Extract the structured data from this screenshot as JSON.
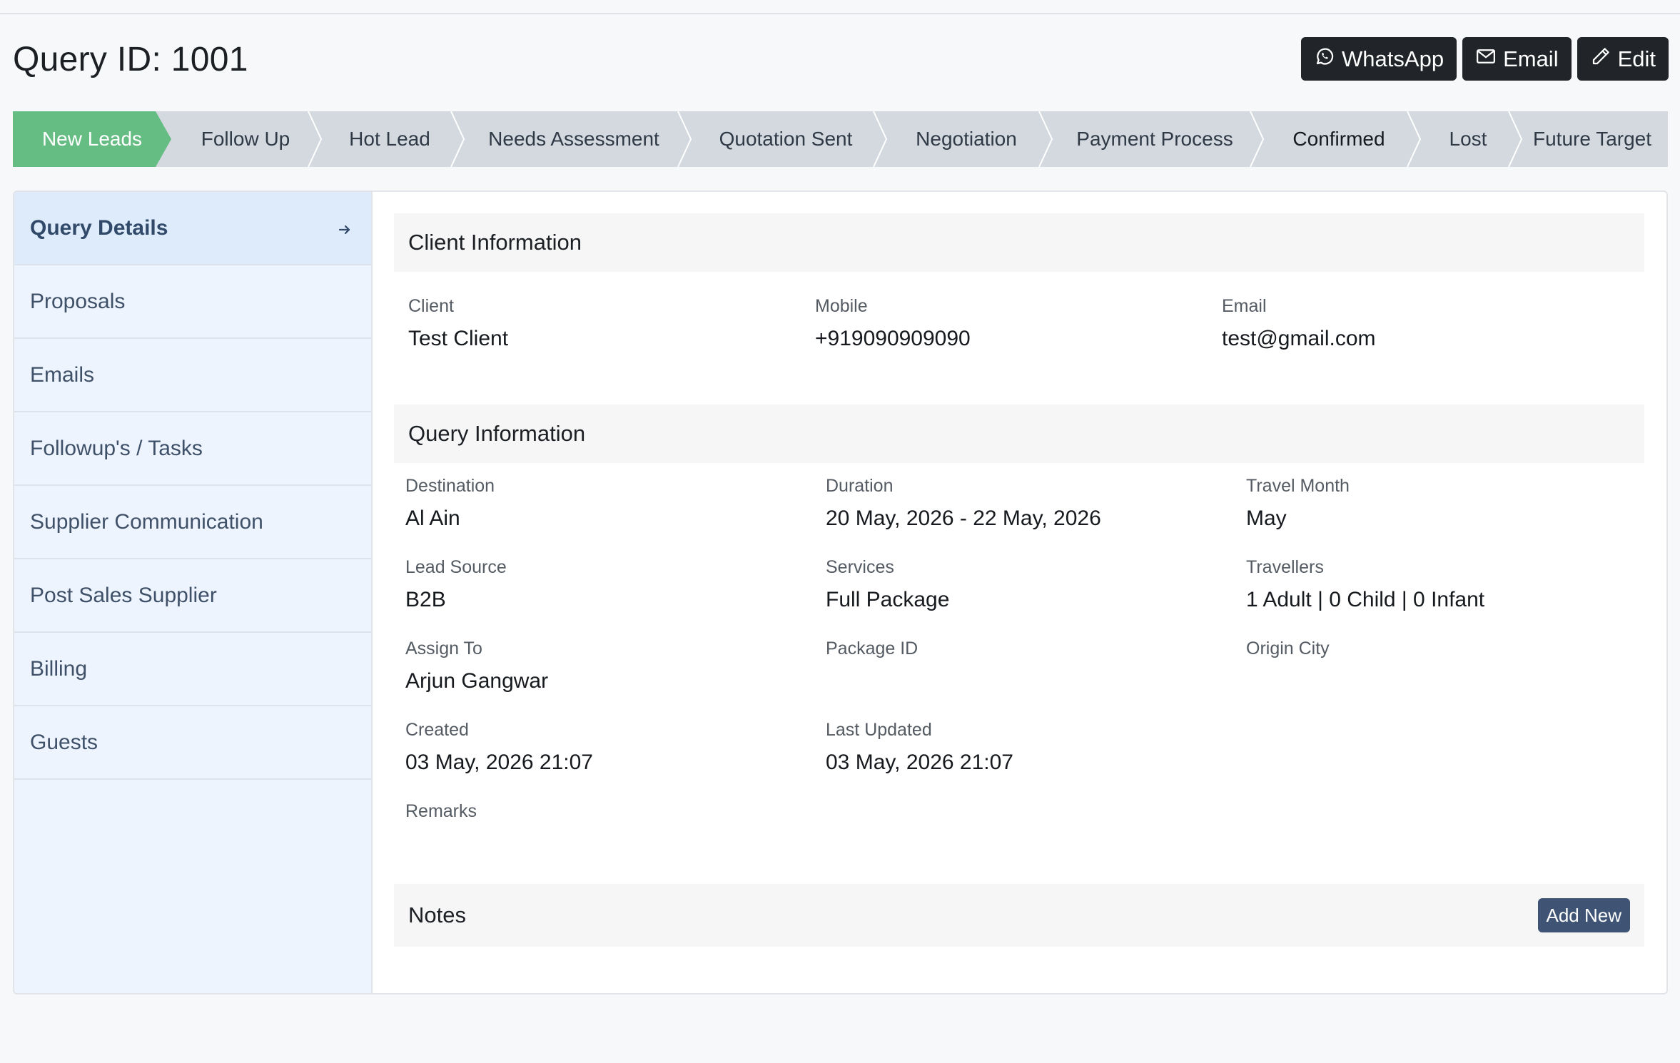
{
  "header": {
    "title": "Query ID: 1001",
    "actions": {
      "whatsapp": "WhatsApp",
      "email": "Email",
      "edit": "Edit"
    }
  },
  "pipeline": {
    "stages": [
      "New Leads",
      "Follow Up",
      "Hot Lead",
      "Needs Assessment",
      "Quotation Sent",
      "Negotiation",
      "Payment Process",
      "Confirmed",
      "Lost",
      "Future Target"
    ],
    "active_stage": "New Leads",
    "colors": {
      "active": "#66bd83",
      "inactive": "#d4d9e0"
    }
  },
  "sidebar": {
    "items": [
      {
        "label": "Query Details"
      },
      {
        "label": "Proposals"
      },
      {
        "label": "Emails"
      },
      {
        "label": "Followup's / Tasks"
      },
      {
        "label": "Supplier Communication"
      },
      {
        "label": "Post Sales Supplier"
      },
      {
        "label": "Billing"
      },
      {
        "label": "Guests"
      }
    ]
  },
  "client_info": {
    "title": "Client Information",
    "client_label": "Client",
    "client_value": "Test Client",
    "mobile_label": "Mobile",
    "mobile_value": "+919090909090",
    "email_label": "Email",
    "email_value": "test@gmail.com"
  },
  "query_info": {
    "title": "Query Information",
    "destination_label": "Destination",
    "destination_value": "Al Ain",
    "duration_label": "Duration",
    "duration_value": "20 May, 2026 - 22 May, 2026",
    "travel_month_label": "Travel Month",
    "travel_month_value": "May",
    "lead_source_label": "Lead Source",
    "lead_source_value": "B2B",
    "services_label": "Services",
    "services_value": "Full Package",
    "travellers_label": "Travellers",
    "travellers_value": "1 Adult | 0 Child | 0 Infant",
    "assign_to_label": "Assign To",
    "assign_to_value": "Arjun Gangwar",
    "package_id_label": "Package ID",
    "origin_city_label": "Origin City",
    "created_label": "Created",
    "created_value": "03 May, 2026 21:07",
    "last_updated_label": "Last Updated",
    "last_updated_value": "03 May, 2026 21:07",
    "remarks_label": "Remarks"
  },
  "notes": {
    "title": "Notes",
    "add_new": "Add New"
  }
}
